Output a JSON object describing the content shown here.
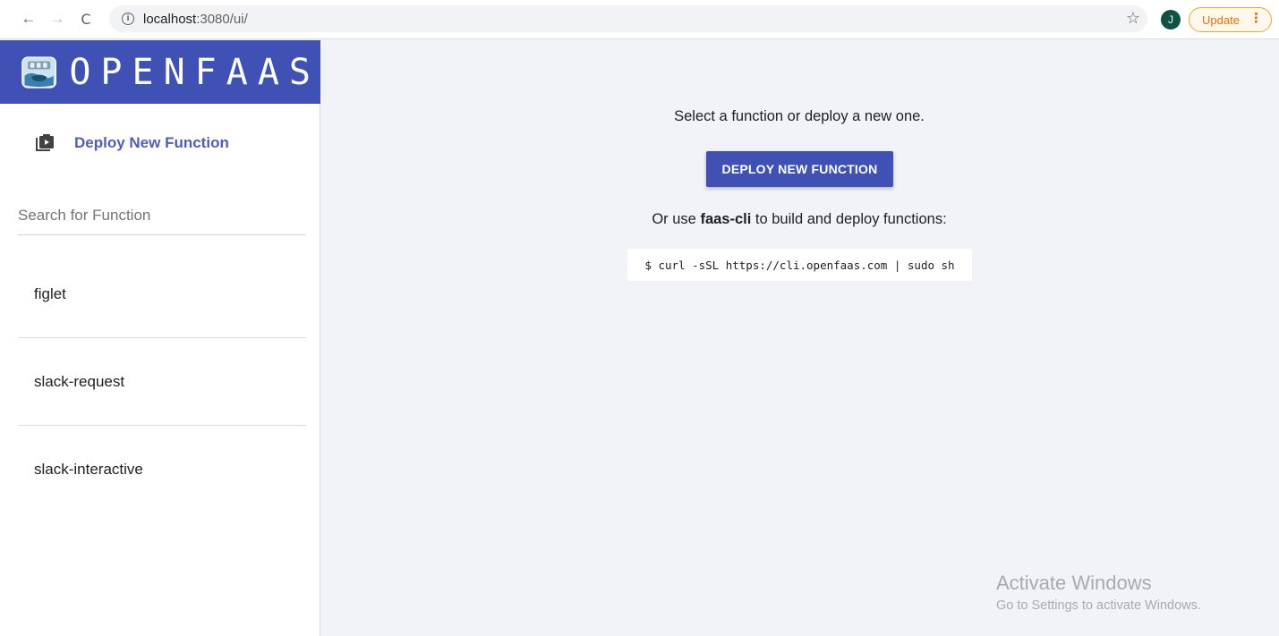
{
  "browser": {
    "back_icon": "←",
    "forward_icon": "→",
    "reload_icon": "C",
    "url_host": "localhost",
    "url_rest": ":3080/ui/",
    "star_icon": "☆",
    "avatar_letter": "J",
    "update_label": "Update",
    "menu_dots": "⋮"
  },
  "sidebar": {
    "brand_text": "OPENFAAS",
    "brand_color": "#3f51b5",
    "deploy_link_label": "Deploy New Function",
    "search_placeholder": "Search for Function",
    "functions": [
      {
        "name": "figlet"
      },
      {
        "name": "slack-request"
      },
      {
        "name": "slack-interactive"
      }
    ]
  },
  "main": {
    "intro_text": "Select a function or deploy a new one.",
    "deploy_button_label": "DEPLOY NEW FUNCTION",
    "cli_prefix": "Or use ",
    "cli_tool": "faas-cli",
    "cli_suffix": " to build and deploy functions:",
    "cli_command": "$ curl -sSL https://cli.openfaas.com | sudo sh"
  },
  "watermark": {
    "title": "Activate Windows",
    "subtitle": "Go to Settings to activate Windows."
  }
}
